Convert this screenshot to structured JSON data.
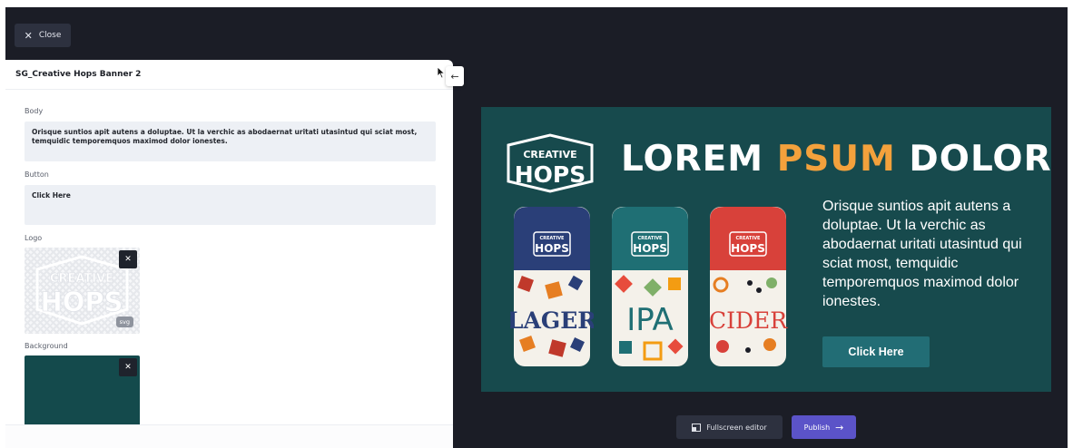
{
  "toolbar": {
    "close_label": "Close"
  },
  "panel": {
    "title": "SG_Creative Hops Banner 2",
    "fields": {
      "body_label": "Body",
      "body_value": "Orisque suntios apit autens a doluptae. Ut la verchic as abodaernat uritati utasintud qui sciat most, temquidic temporemquos maximod dolor ionestes.",
      "button_label": "Button",
      "button_value": "Click Here",
      "logo_label": "Logo",
      "logo_badge": "svg",
      "background_label": "Background"
    }
  },
  "logo": {
    "line1": "CREATIVE",
    "line2": "HOPS"
  },
  "banner": {
    "headline_1": "LOREM",
    "headline_2": "PSUM",
    "headline_3": "DOLOR",
    "body": "Orisque suntios apit autens a doluptae. Ut la verchic as abodaernat uritati utasintud qui sciat most, temquidic temporemquos maximod dolor ionestes.",
    "cta": "Click Here",
    "cans": [
      {
        "brand": "HOPS",
        "top": "CREATIVE",
        "name": "LAGER"
      },
      {
        "brand": "HOPS",
        "top": "CREATIVE",
        "name": "IPA"
      },
      {
        "brand": "HOPS",
        "top": "CREATIVE",
        "name": "CIDER"
      }
    ]
  },
  "footer": {
    "fullscreen_label": "Fullscreen editor",
    "publish_label": "Publish"
  },
  "colors": {
    "app_bg": "#1b1d26",
    "banner_bg": "#174a4d",
    "accent": "#f3a13c",
    "publish": "#5b53c8"
  }
}
